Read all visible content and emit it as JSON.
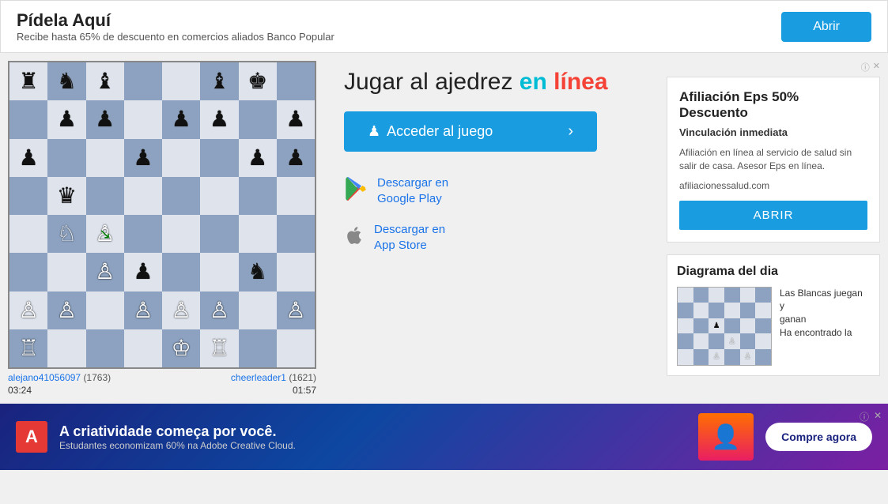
{
  "top_ad": {
    "title": "Pídela Aquí",
    "subtitle": "Recibe hasta 65% de descuento en comercios aliados Banco Popular",
    "button_label": "Abrir"
  },
  "chess": {
    "player_left": "alejano41056097",
    "rating_left": "(1763)",
    "player_right": "cheerleader1",
    "rating_right": "(1621)",
    "timer_left": "03:24",
    "timer_right": "01:57"
  },
  "center": {
    "title_part1": "Jugar al ajedrez ",
    "title_part2": "en línea",
    "play_button": "Acceder al juego",
    "download_google_line1": "Descargar en",
    "download_google_line2": "Google Play",
    "download_apple_line1": "Descargar en",
    "download_apple_line2": "App Store"
  },
  "right_ad": {
    "close_label": "ⓘ ✕",
    "title": "Afiliación Eps 50% Descuento",
    "subtitle": "Vinculación inmediata",
    "description": "Afiliación en línea al servicio de salud sin salir de casa. Asesor Eps en línea.",
    "site": "afiliacionessalud.com",
    "button_label": "ABRIR"
  },
  "diagrama": {
    "title": "Diagrama del dia",
    "description_line1": "Las Blancas juegan y",
    "description_line2": "ganan",
    "description_line3": "Ha encontrado la"
  },
  "bottom_ad": {
    "logo": "A",
    "company": "Adobe",
    "headline": "A criatividade começa por você.",
    "subtext": "Estudantes economizam 60% na Adobe Creative Cloud.",
    "button_label": "Compre agora"
  }
}
